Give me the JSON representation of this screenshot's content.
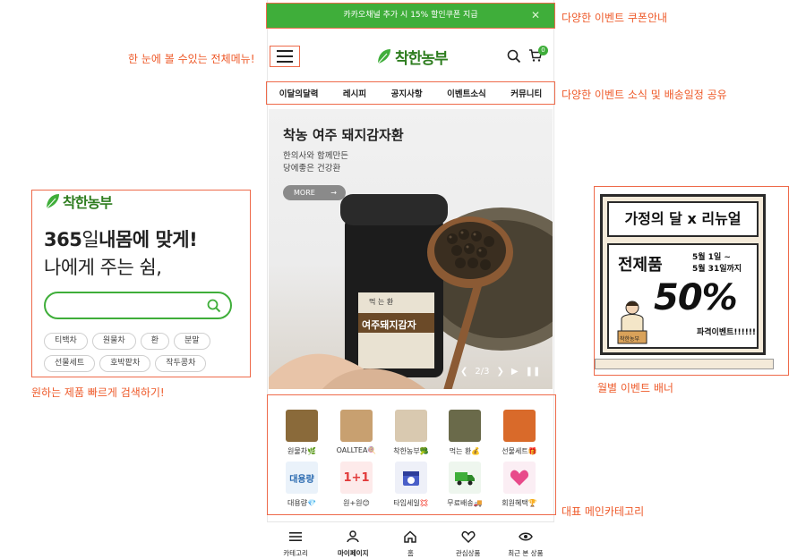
{
  "coupon_bar": {
    "text": "카카오채널 추가 시 15% 할인쿠폰 지급",
    "close": "✕"
  },
  "header": {
    "logo_text": "착한농부",
    "cart_count": "0"
  },
  "nav": {
    "items": [
      "이달의달력",
      "레시피",
      "공지사항",
      "이벤트소식",
      "커뮤니티"
    ]
  },
  "hero": {
    "title": "착농 여주 돼지감자환",
    "subtitle_line1": "한의사와 함께만든",
    "subtitle_line2": "당에좋은 건강환",
    "more_label": "MORE",
    "more_arrow": "→",
    "counter": "2/3",
    "jar_label": "여주돼지감자",
    "jar_top_label": "먹 는 환"
  },
  "promo": {
    "logo_text": "착한농부",
    "headline_num": "365",
    "headline_light": "일",
    "headline_rest": "내몸에 맞게!",
    "headline2": "나에게 주는 쉼,",
    "tags": [
      "티백차",
      "원물차",
      "환",
      "분말",
      "선물세트",
      "호박팥차",
      "작두콩차"
    ]
  },
  "event_banner": {
    "top": "가정의 달 x 리뉴얼",
    "main": "전제품",
    "date1": "5월 1일 ~",
    "date2": "5월 31일까지",
    "percent": "50%",
    "burst": "파격이벤트!!!!!!",
    "box_text": "착한농부"
  },
  "categories": [
    {
      "label": "원물차🌿",
      "color": "#8a6a3a"
    },
    {
      "label": "OALLTEA🍭",
      "color": "#c8a070"
    },
    {
      "label": "착한농부🥦",
      "color": "#d9c9b0"
    },
    {
      "label": "먹는 환💰",
      "color": "#6a6a4a"
    },
    {
      "label": "선물세트🎁",
      "color": "#d96a2a"
    },
    {
      "label": "대용량💎",
      "thumb": "대용량",
      "color": "#eaf2fa"
    },
    {
      "label": "원+원😊",
      "thumb": "1+1",
      "color": "#fdeaea"
    },
    {
      "label": "타임세일💢",
      "color": "#eef0f8"
    },
    {
      "label": "무료배송🚚",
      "color": "#eef6ee"
    },
    {
      "label": "회원혜택🏆",
      "color": "#fbeef4"
    }
  ],
  "tabbar": {
    "items": [
      "카테고리",
      "마이페이지",
      "홈",
      "관심상품",
      "최근 본 상품"
    ]
  },
  "annotations": {
    "coupon": "다양한 이벤트 쿠폰안내",
    "menu": "한 눈에 볼 수있는 전체메뉴!",
    "nav": "다양한 이벤트 소식 및 배송일정 공유",
    "search": "원하는 제품 빠르게 검색하기!",
    "banner": "월별 이벤트 배너",
    "category": "대표 메인카테고리"
  },
  "colors": {
    "brand_green": "#3fae3a",
    "annotation": "#ee5a2a"
  }
}
